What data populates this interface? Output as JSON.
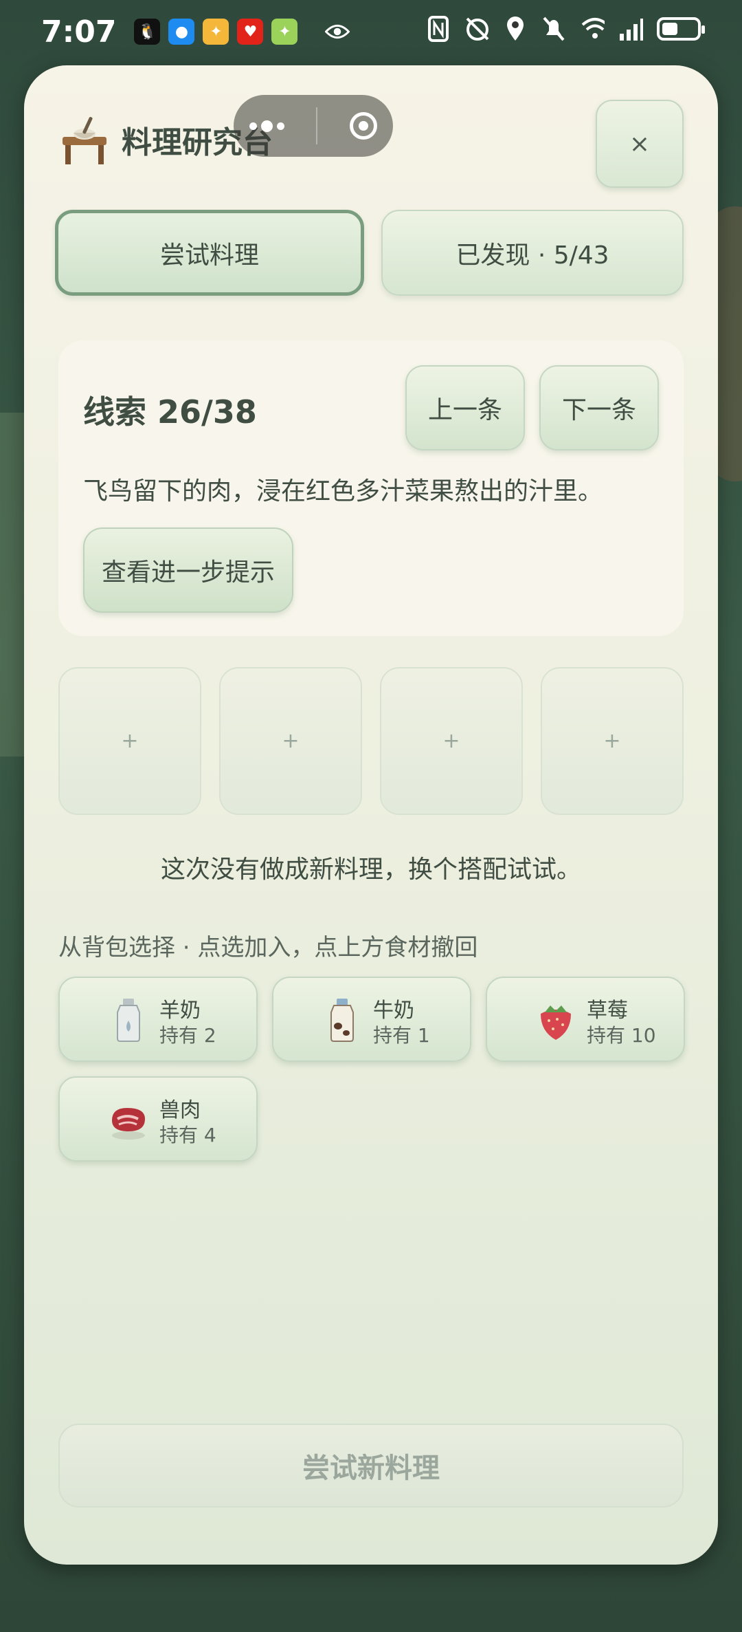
{
  "status_bar": {
    "time": "7:07",
    "icons": [
      "qq-icon",
      "message-icon",
      "app-icon",
      "health-icon",
      "app-icon",
      "eye-icon",
      "nfc-icon",
      "alarm-off-icon",
      "location-icon",
      "mute-icon",
      "wifi-icon",
      "signal-icon",
      "battery-icon"
    ]
  },
  "panel": {
    "title": "料理研究台",
    "close_label": "×"
  },
  "tabs": [
    {
      "label": "尝试料理",
      "active": true
    },
    {
      "label": "已发现 · 5/43",
      "active": false
    }
  ],
  "clue": {
    "title": "线索 26/38",
    "prev_label": "上一条",
    "next_label": "下一条",
    "text": "飞鸟留下的肉，浸在红色多汁菜果熬出的汁里。",
    "hint_label": "查看进一步提示"
  },
  "slots": [
    "+",
    "+",
    "+",
    "+"
  ],
  "result_message": "这次没有做成新料理，换个搭配试试。",
  "backpack_label": "从背包选择 · 点选加入，点上方食材撤回",
  "ingredients": [
    {
      "name": "羊奶",
      "count": "持有 2",
      "icon": "goat-milk-icon"
    },
    {
      "name": "牛奶",
      "count": "持有 1",
      "icon": "milk-icon"
    },
    {
      "name": "草莓",
      "count": "持有 10",
      "icon": "strawberry-icon"
    },
    {
      "name": "兽肉",
      "count": "持有 4",
      "icon": "meat-icon"
    }
  ],
  "try_button_label": "尝试新料理",
  "colors": {
    "panel_bg": "#f6f3e7",
    "accent_green": "#7a9d7f",
    "text_dark": "#3f4d43"
  }
}
